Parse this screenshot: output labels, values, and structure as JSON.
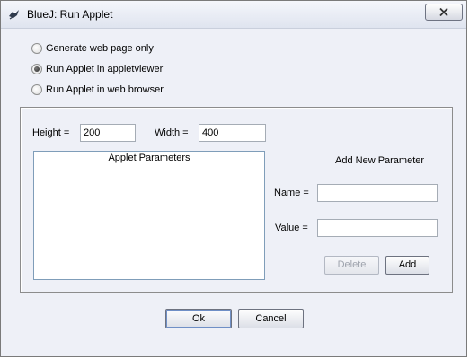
{
  "window": {
    "title": "BlueJ:  Run Applet",
    "close_icon": "close-icon",
    "app_icon": "bluej-bird-icon"
  },
  "run_options": [
    {
      "label": "Generate web page only",
      "selected": false
    },
    {
      "label": "Run Applet in appletviewer",
      "selected": true
    },
    {
      "label": "Run Applet in web browser",
      "selected": false
    }
  ],
  "size": {
    "height_label": "Height =",
    "height_value": "200",
    "width_label": "Width =",
    "width_value": "400"
  },
  "parameters": {
    "list_header": "Applet Parameters",
    "items": []
  },
  "new_parameter": {
    "title": "Add New Parameter",
    "name_label": "Name =",
    "name_value": "",
    "value_label": "Value =",
    "value_value": "",
    "delete_label": "Delete",
    "delete_enabled": false,
    "add_label": "Add"
  },
  "footer": {
    "ok_label": "Ok",
    "cancel_label": "Cancel"
  }
}
